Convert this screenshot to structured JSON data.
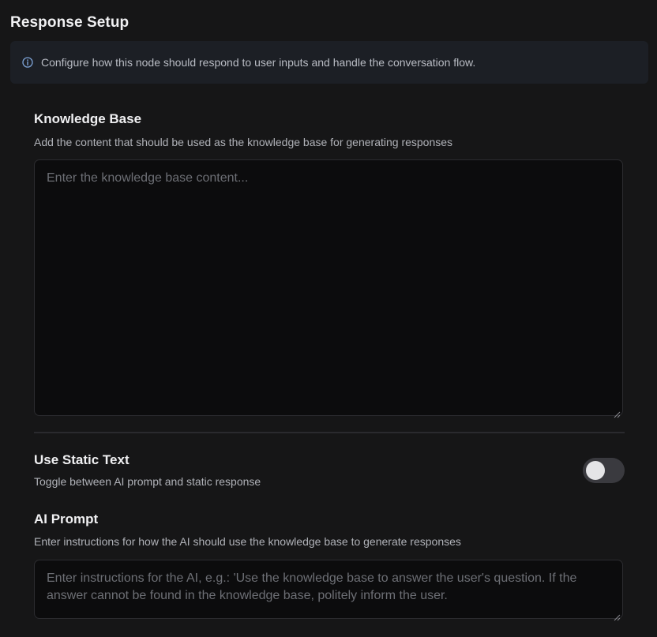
{
  "header": {
    "title": "Response Setup"
  },
  "info": {
    "icon": "info-circle-icon",
    "text": "Configure how this node should respond to user inputs and handle the conversation flow.",
    "accent_color": "#7ea4d8"
  },
  "knowledge_base": {
    "title": "Knowledge Base",
    "description": "Add the content that should be used as the knowledge base for generating responses",
    "value": "",
    "placeholder": "Enter the knowledge base content..."
  },
  "static_text": {
    "title": "Use Static Text",
    "description": "Toggle between AI prompt and static response",
    "enabled": false
  },
  "ai_prompt": {
    "title": "AI Prompt",
    "description": "Enter instructions for how the AI should use the knowledge base to generate responses",
    "value": "",
    "placeholder": "Enter instructions for the AI, e.g.: 'Use the knowledge base to answer the user's question. If the answer cannot be found in the knowledge base, politely inform the user."
  }
}
